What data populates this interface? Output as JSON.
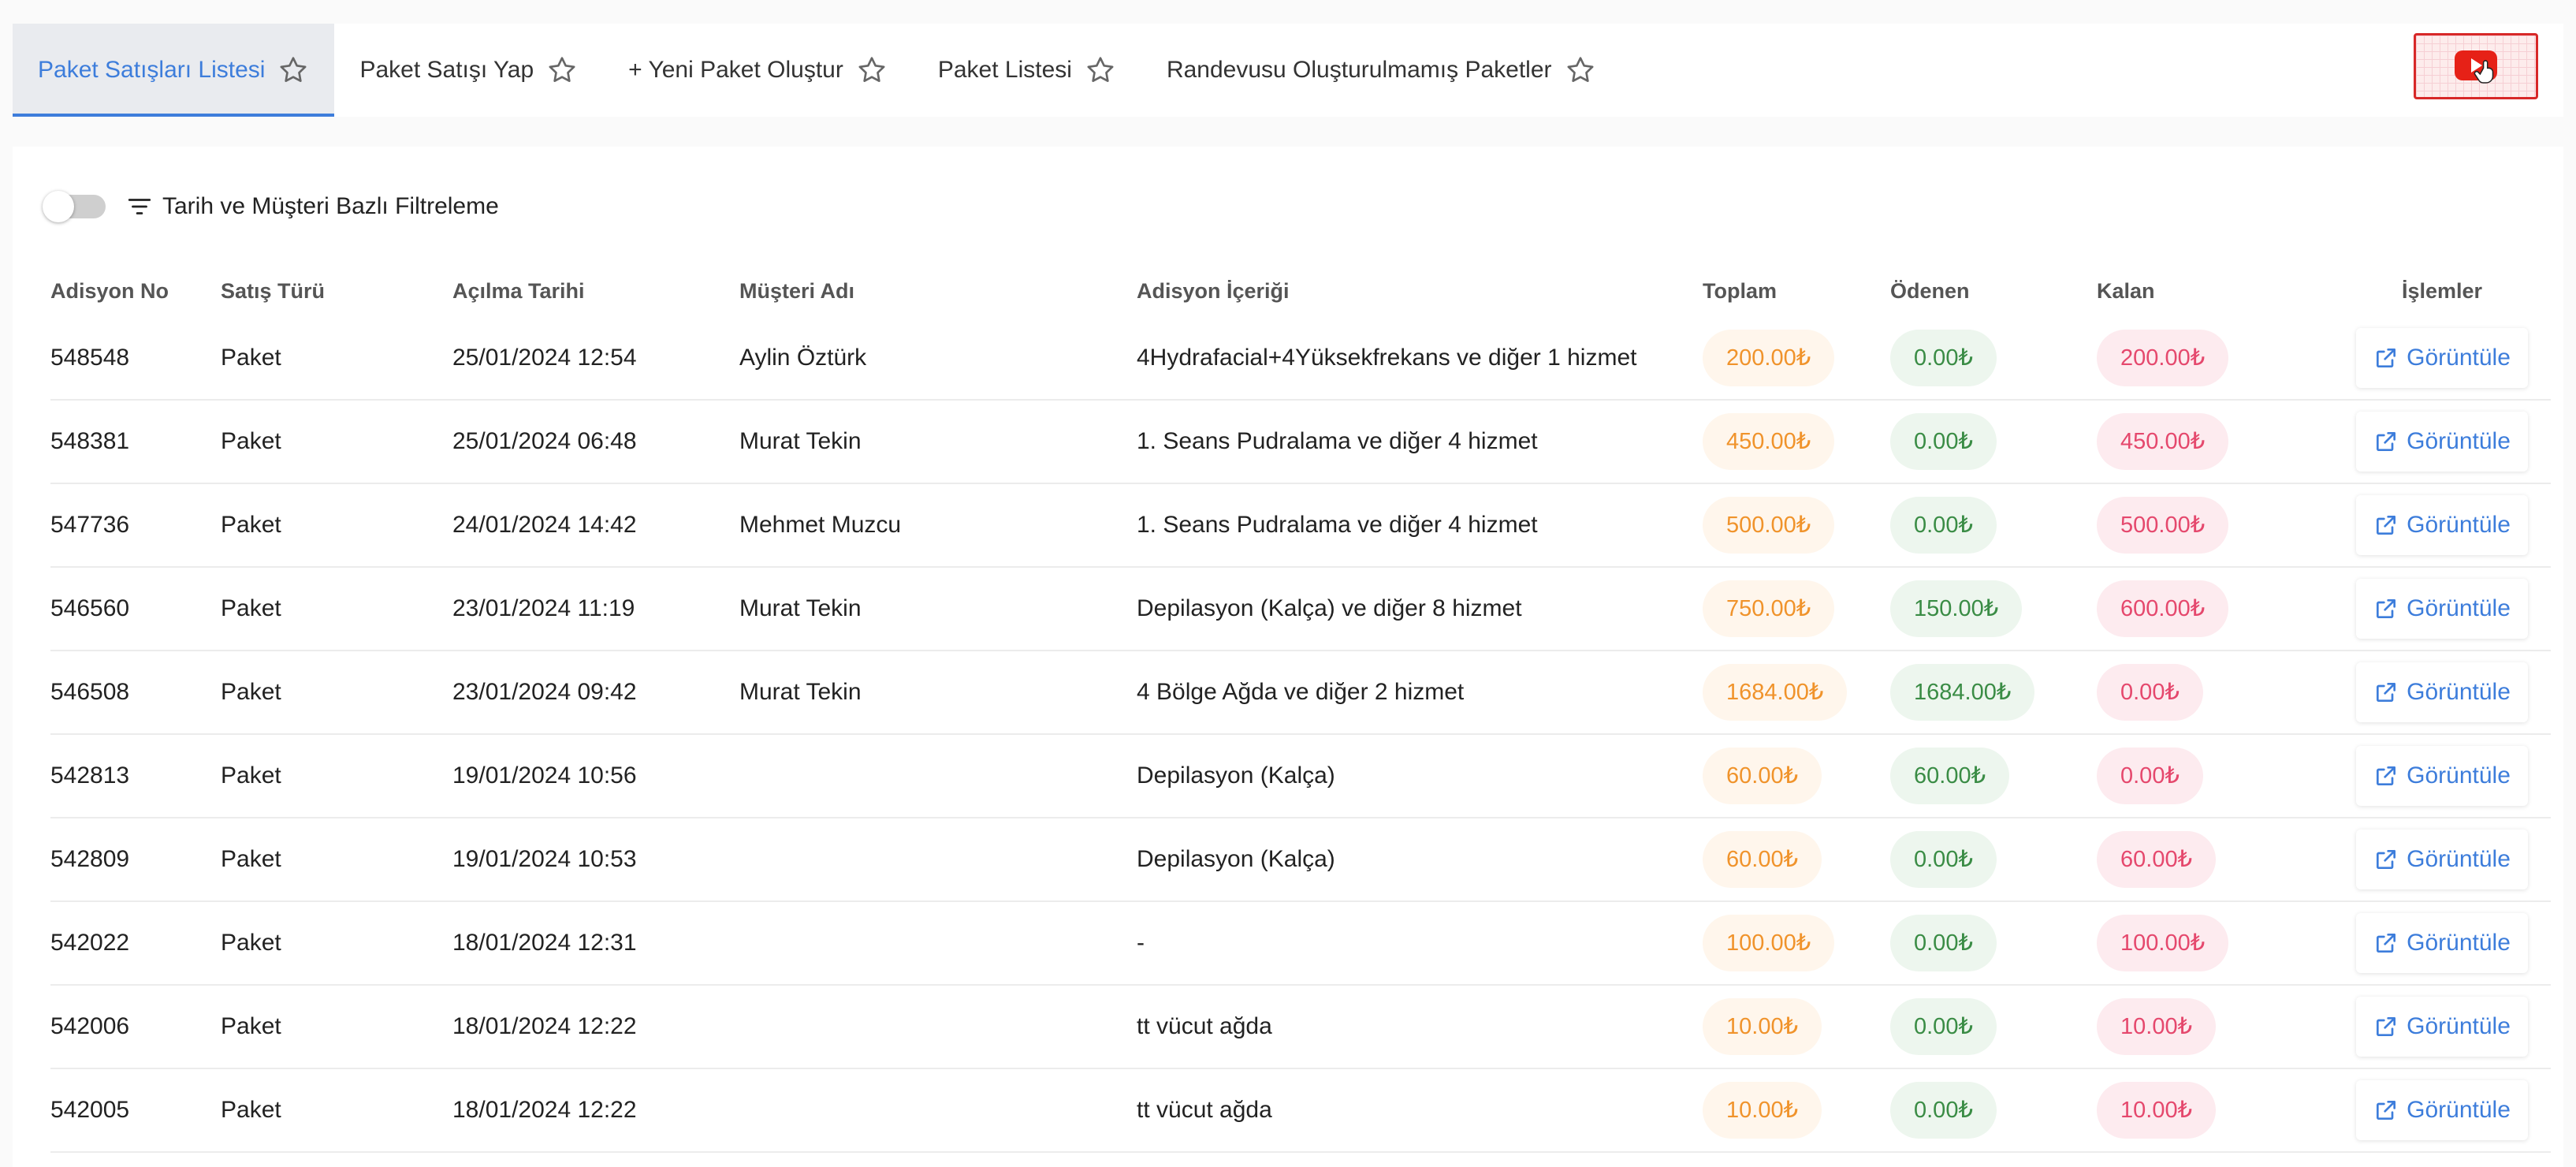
{
  "tabs": [
    {
      "label": "Paket Satışları Listesi",
      "active": true
    },
    {
      "label": "Paket Satışı Yap",
      "active": false
    },
    {
      "label": "+ Yeni Paket Oluştur",
      "active": false
    },
    {
      "label": "Paket Listesi",
      "active": false
    },
    {
      "label": "Randevusu Oluşturulmamış Paketler",
      "active": false
    }
  ],
  "filter": {
    "label": "Tarih ve Müşteri Bazlı Filtreleme",
    "enabled": false
  },
  "table": {
    "headers": [
      "Adisyon No",
      "Satış Türü",
      "Açılma Tarihi",
      "Müşteri Adı",
      "Adisyon İçeriği",
      "Toplam",
      "Ödenen",
      "Kalan",
      "İşlemler"
    ],
    "action_label": "Görüntüle",
    "rows": [
      {
        "no": "548548",
        "type": "Paket",
        "date": "25/01/2024 12:54",
        "customer": "Aylin Öztürk",
        "content": "4Hydrafacial+4Yüksekfrekans ve diğer 1 hizmet",
        "total": "200.00₺",
        "paid": "0.00₺",
        "remaining": "200.00₺"
      },
      {
        "no": "548381",
        "type": "Paket",
        "date": "25/01/2024 06:48",
        "customer": "Murat Tekin",
        "content": "1. Seans Pudralama ve diğer 4 hizmet",
        "total": "450.00₺",
        "paid": "0.00₺",
        "remaining": "450.00₺"
      },
      {
        "no": "547736",
        "type": "Paket",
        "date": "24/01/2024 14:42",
        "customer": "Mehmet Muzcu",
        "content": "1. Seans Pudralama ve diğer 4 hizmet",
        "total": "500.00₺",
        "paid": "0.00₺",
        "remaining": "500.00₺"
      },
      {
        "no": "546560",
        "type": "Paket",
        "date": "23/01/2024 11:19",
        "customer": "Murat Tekin",
        "content": "Depilasyon (Kalça) ve diğer 8 hizmet",
        "total": "750.00₺",
        "paid": "150.00₺",
        "remaining": "600.00₺"
      },
      {
        "no": "546508",
        "type": "Paket",
        "date": "23/01/2024 09:42",
        "customer": "Murat Tekin",
        "content": "4 Bölge Ağda ve diğer 2 hizmet",
        "total": "1684.00₺",
        "paid": "1684.00₺",
        "remaining": "0.00₺"
      },
      {
        "no": "542813",
        "type": "Paket",
        "date": "19/01/2024 10:56",
        "customer": "",
        "content": "Depilasyon (Kalça)",
        "total": "60.00₺",
        "paid": "60.00₺",
        "remaining": "0.00₺"
      },
      {
        "no": "542809",
        "type": "Paket",
        "date": "19/01/2024 10:53",
        "customer": "",
        "content": "Depilasyon (Kalça)",
        "total": "60.00₺",
        "paid": "0.00₺",
        "remaining": "60.00₺"
      },
      {
        "no": "542022",
        "type": "Paket",
        "date": "18/01/2024 12:31",
        "customer": "",
        "content": "-",
        "total": "100.00₺",
        "paid": "0.00₺",
        "remaining": "100.00₺"
      },
      {
        "no": "542006",
        "type": "Paket",
        "date": "18/01/2024 12:22",
        "customer": "",
        "content": "tt vücut ağda",
        "total": "10.00₺",
        "paid": "0.00₺",
        "remaining": "10.00₺"
      },
      {
        "no": "542005",
        "type": "Paket",
        "date": "18/01/2024 12:22",
        "customer": "",
        "content": "tt vücut ağda",
        "total": "10.00₺",
        "paid": "0.00₺",
        "remaining": "10.00₺"
      }
    ]
  },
  "icons": {
    "tab_favorite": "star-outline-icon",
    "video_help": "youtube-play-icon",
    "filter": "filter-lines-icon",
    "view": "external-link-icon"
  },
  "colors": {
    "accent": "#3d7ddb",
    "total": "#f0932b",
    "paid": "#3a8c45",
    "remaining": "#e5486d",
    "youtube": "#e62117"
  }
}
